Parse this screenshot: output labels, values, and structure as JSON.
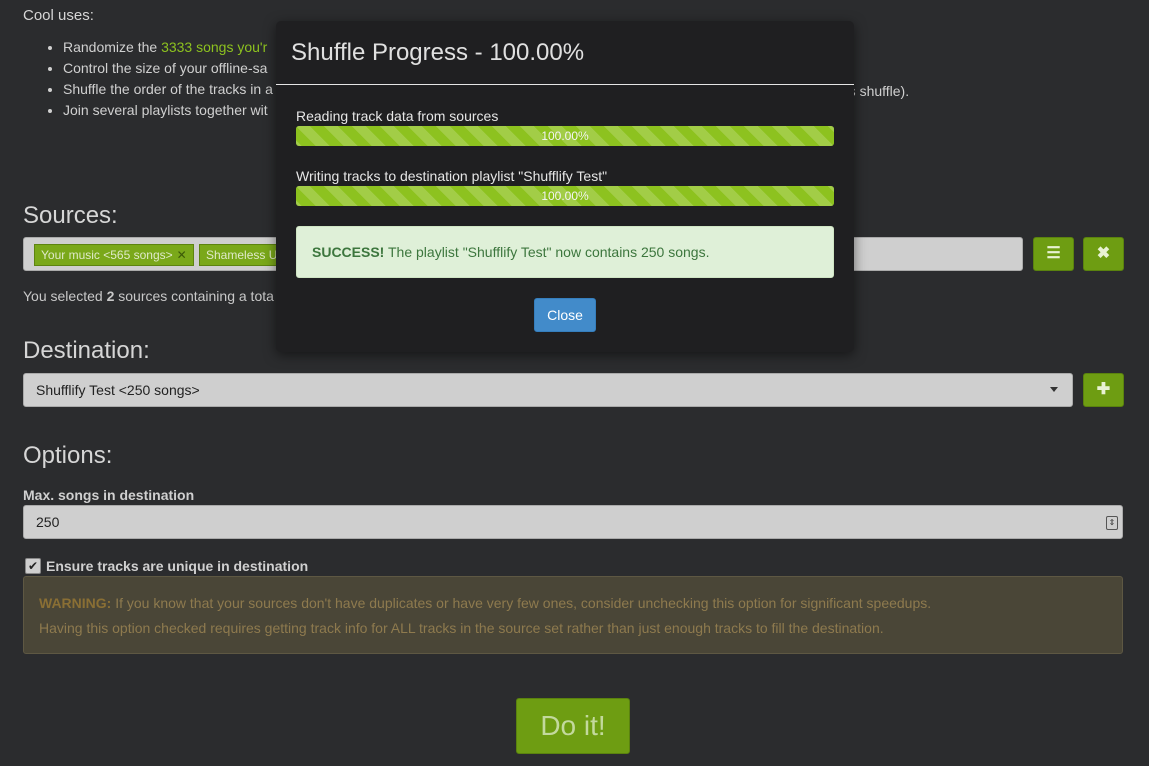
{
  "background": {
    "intro": "Cool uses:",
    "uses": [
      {
        "before": "Randomize the ",
        "link": "3333 songs you'r",
        "after": ""
      },
      {
        "before": "Control the size of your offline-sa",
        "link": "",
        "after": ""
      },
      {
        "before": "Shuffle the order of the tracks in a",
        "link": "",
        "after": ""
      },
      {
        "before": "Join several playlists together wit",
        "link": "",
        "after": ""
      }
    ],
    "uses_tail": "'s shuffle).",
    "sources_heading": "Sources:",
    "source_tags": [
      "Your music <565 songs>",
      "Shameless U"
    ],
    "selected_note": {
      "before": "You selected ",
      "count": "2",
      "after": " sources containing a tota"
    },
    "destination_heading": "Destination:",
    "destination_value": "Shufflify Test <250 songs>",
    "options_heading": "Options:",
    "max_songs_label": "Max. songs in destination",
    "max_songs_value": "250",
    "unique_label": "Ensure tracks are unique in destination",
    "warning": {
      "strong": "WARNING:",
      "line1": " If you know that your sources don't have duplicates or have very few ones, consider unchecking this option for significant speedups.",
      "line2": "Having this option checked requires getting track info for ALL tracks in the source set rather than just enough tracks to fill the destination."
    },
    "doit_label": "Do it!"
  },
  "modal": {
    "title": "Shuffle Progress - 100.00%",
    "progress": [
      {
        "label": "Reading track data from sources",
        "value": 100,
        "text": "100.00%"
      },
      {
        "label": "Writing tracks to destination playlist \"Shufflify Test\"",
        "value": 100,
        "text": "100.00%"
      }
    ],
    "success_strong": "SUCCESS!",
    "success_text": " The playlist \"Shufflify Test\" now contains 250 songs.",
    "close_label": "Close"
  },
  "icons": {
    "list": "list-icon",
    "remove": "times-icon",
    "add": "plus-icon",
    "check": "checkmark-icon"
  },
  "colors": {
    "accent_green": "#8dc21f",
    "button_green": "#6e9d12",
    "close_blue": "#428bca",
    "success_bg": "#dff0d8"
  }
}
